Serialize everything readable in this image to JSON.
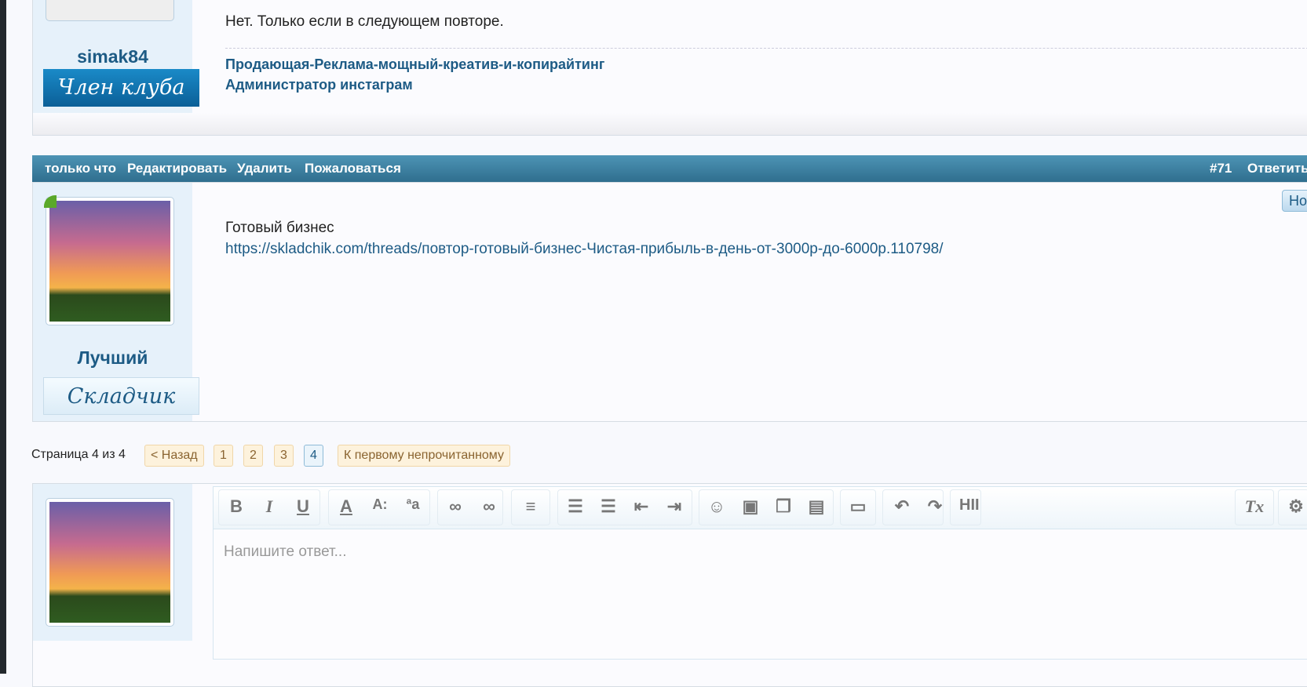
{
  "post1": {
    "text": "Нет. Только если в следующем повторе.",
    "signature": [
      "Продающая-Реклама-мощный-креатив-и-копирайтинг",
      "Администратор инстаграм"
    ],
    "username": "simak84",
    "badge": "Член клуба"
  },
  "bar": {
    "time": "только что",
    "edit": "Редактировать",
    "delete": "Удалить",
    "report": "Пожаловаться",
    "number": "#71",
    "reply": "Ответить"
  },
  "post2": {
    "text": "Готовый бизнес",
    "link": "https://skladchik.com/threads/повтор-готовый-бизнес-Чистая-прибыль-в-день-от-3000р-до-6000р.110798/",
    "username": "Лучший",
    "badge": "Складчик",
    "new_label": "Но"
  },
  "pagination": {
    "label": "Страница 4 из 4",
    "prev": "< Назад",
    "pages": [
      "1",
      "2",
      "3",
      "4"
    ],
    "current": "4",
    "first_unread": "К первому непрочитанному"
  },
  "editor": {
    "placeholder": "Напишите ответ...",
    "hide_label": "HII"
  }
}
